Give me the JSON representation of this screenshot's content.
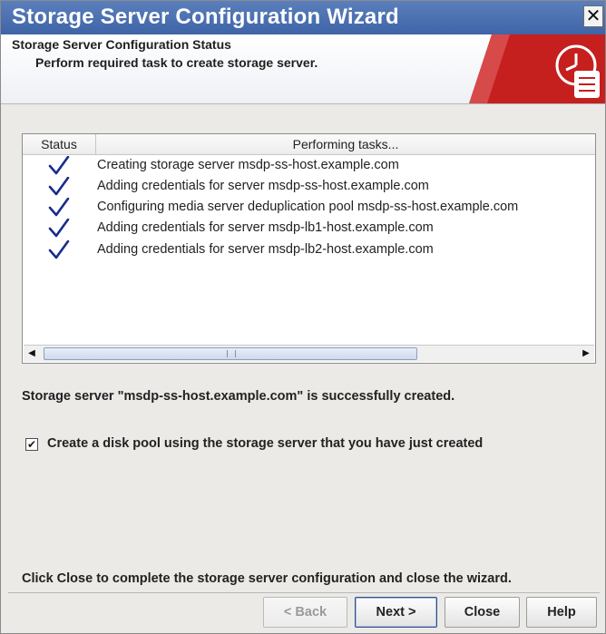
{
  "window": {
    "title": "Storage Server Configuration Wizard",
    "close_glyph": "✕",
    "colors": {
      "titlebar": "#4a6fb1",
      "accent": "#c8201f",
      "check": "#1a2b8c"
    }
  },
  "header": {
    "title": "Storage Server Configuration Status",
    "subtitle": "Perform required task to create storage server.",
    "icon": "clock-scroll-icon"
  },
  "tasks_table": {
    "columns": [
      "Status",
      "Performing tasks..."
    ],
    "rows": [
      {
        "status": "complete",
        "text": "Creating storage server msdp-ss-host.example.com"
      },
      {
        "status": "complete",
        "text": "Adding credentials for server msdp-ss-host.example.com"
      },
      {
        "status": "complete",
        "text": "Configuring media server deduplication pool msdp-ss-host.example.com"
      },
      {
        "status": "complete",
        "text": "Adding credentials for server msdp-lb1-host.example.com"
      },
      {
        "status": "complete",
        "text": "Adding credentials for server msdp-lb2-host.example.com"
      }
    ]
  },
  "status_message": "Storage server \"msdp-ss-host.example.com\" is successfully created.",
  "disk_pool_option": {
    "label": "Create a disk pool using the storage server that you have just created",
    "checked": true,
    "check_glyph": "✔"
  },
  "footer_message": "Click Close to complete the storage server configuration and close the wizard.",
  "buttons": {
    "back": "< Back",
    "next": "Next >",
    "close": "Close",
    "help": "Help"
  }
}
